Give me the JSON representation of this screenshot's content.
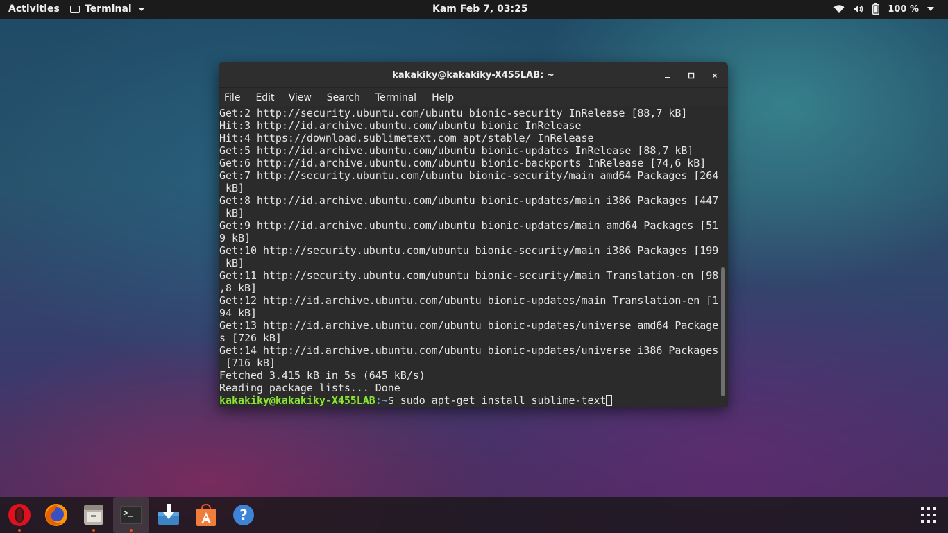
{
  "topbar": {
    "activities": "Activities",
    "app_menu": "Terminal",
    "clock": "Kam Feb  7, 03:25",
    "battery": "100 %",
    "icons": [
      "wifi-icon",
      "volume-icon",
      "battery-icon"
    ]
  },
  "window": {
    "title": "kakakiky@kakakiky-X455LAB: ~",
    "menu": [
      "File",
      "Edit",
      "View",
      "Search",
      "Terminal",
      "Help"
    ],
    "lines": [
      "Get:2 http://security.ubuntu.com/ubuntu bionic-security InRelease [88,7 kB]",
      "Hit:3 http://id.archive.ubuntu.com/ubuntu bionic InRelease",
      "Hit:4 https://download.sublimetext.com apt/stable/ InRelease",
      "Get:5 http://id.archive.ubuntu.com/ubuntu bionic-updates InRelease [88,7 kB]",
      "Get:6 http://id.archive.ubuntu.com/ubuntu bionic-backports InRelease [74,6 kB]",
      "Get:7 http://security.ubuntu.com/ubuntu bionic-security/main amd64 Packages [264",
      " kB]",
      "Get:8 http://id.archive.ubuntu.com/ubuntu bionic-updates/main i386 Packages [447",
      " kB]",
      "Get:9 http://id.archive.ubuntu.com/ubuntu bionic-updates/main amd64 Packages [51",
      "9 kB]",
      "Get:10 http://security.ubuntu.com/ubuntu bionic-security/main i386 Packages [199",
      " kB]",
      "Get:11 http://security.ubuntu.com/ubuntu bionic-security/main Translation-en [98",
      ",8 kB]",
      "Get:12 http://id.archive.ubuntu.com/ubuntu bionic-updates/main Translation-en [1",
      "94 kB]",
      "Get:13 http://id.archive.ubuntu.com/ubuntu bionic-updates/universe amd64 Package",
      "s [726 kB]",
      "Get:14 http://id.archive.ubuntu.com/ubuntu bionic-updates/universe i386 Packages",
      " [716 kB]",
      "Fetched 3.415 kB in 5s (645 kB/s)",
      "Reading package lists... Done"
    ],
    "prompt_user": "kakakiky@kakakiky-X455LAB",
    "prompt_path": ":~",
    "prompt_symbol": "$ ",
    "command": "sudo apt-get install sublime-text"
  },
  "dock": {
    "apps": [
      "opera-icon",
      "firefox-icon",
      "files-icon",
      "terminal-icon",
      "installer-icon",
      "software-center-icon",
      "help-icon",
      "show-applications-icon"
    ],
    "colors": {
      "running_dot": "#e95420",
      "prompt_user": "#8ae234",
      "prompt_path": "#729fcf"
    }
  }
}
